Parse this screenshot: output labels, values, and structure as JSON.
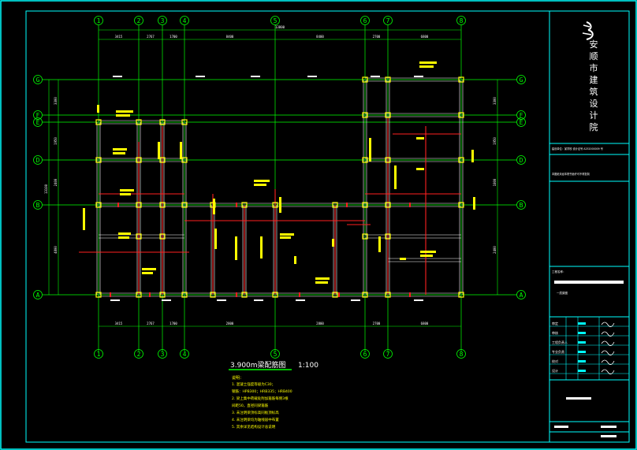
{
  "drawing": {
    "title": "3.900m梁配筋图",
    "scale": "1:100",
    "column_axes": [
      "1",
      "2",
      "3",
      "4",
      "5",
      "6",
      "7",
      "8"
    ],
    "row_axes": [
      "A",
      "B",
      "D",
      "E",
      "F",
      "G"
    ],
    "top_dims": [
      "3415",
      "2767",
      "1700",
      "8400",
      "8400",
      "2700",
      "6800"
    ],
    "top_total": "13800",
    "bottom_dims": [
      "3415",
      "2767",
      "1700",
      "2800",
      "2800",
      "2700",
      "6800"
    ],
    "left_dims": [
      "3300",
      "1950",
      "2400",
      "4800"
    ],
    "left_total": "13100",
    "right_dims": [
      "3300",
      "1950",
      "1800",
      "2400",
      "4800"
    ],
    "notes_title": "说明：",
    "notes": [
      "1. 混凝土强度等级为C30；",
      "   钢筋：HPB300；HRB335；HRB400",
      "2. 梁上集中荷载处附加箍筋每侧3根",
      "   间距50，直径同梁箍筋",
      "3. 未注明梁顶标高同板顶标高",
      "4. 未注明梁均为轴线居中布置",
      "5. 其余详见结构设计总说明"
    ]
  },
  "title_block": {
    "institute_name": "安顺市建筑设计院",
    "line1": "建设单位：某学校  设计证号 A252000009 号",
    "line2": "本图纸未经本院书面许可不得复制",
    "project_label": "工程名称：",
    "drawing_label": "一层梁图",
    "row_labels": [
      "审定",
      "审核",
      "工程负责人",
      "专业负责",
      "校对",
      "设计"
    ]
  },
  "colors": {
    "background": "#000000",
    "frame": "#00ffff",
    "axis": "#00ff00",
    "beam": "#ff2020",
    "column": "#ffff00",
    "beam_text": "#ffff00",
    "wall": "#ffffff"
  }
}
